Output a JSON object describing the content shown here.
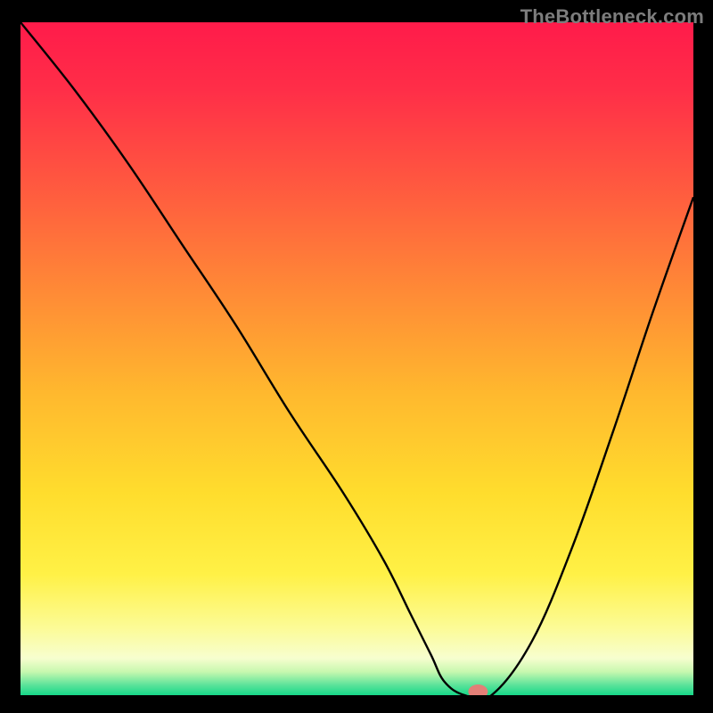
{
  "watermark": "TheBottleneck.com",
  "chart_data": {
    "type": "line",
    "title": "",
    "xlabel": "",
    "ylabel": "",
    "xlim": [
      0,
      100
    ],
    "ylim": [
      0,
      100
    ],
    "x": [
      0,
      8,
      16,
      24,
      32,
      40,
      48,
      54,
      58,
      61,
      63,
      66,
      70,
      76,
      82,
      88,
      94,
      100
    ],
    "values": [
      100,
      90,
      79,
      67,
      55,
      42,
      30,
      20,
      12,
      6,
      2,
      0,
      0,
      8,
      22,
      39,
      57,
      74
    ],
    "minimum_region": {
      "x_start": 63,
      "x_end": 70,
      "y": 0
    },
    "optimal_marker": {
      "x": 68,
      "y": 0
    },
    "gradient_stops": [
      {
        "offset": 0.0,
        "color": "#ff1b4a"
      },
      {
        "offset": 0.1,
        "color": "#ff2e48"
      },
      {
        "offset": 0.25,
        "color": "#ff5b3f"
      },
      {
        "offset": 0.4,
        "color": "#ff8a36"
      },
      {
        "offset": 0.55,
        "color": "#ffb82e"
      },
      {
        "offset": 0.7,
        "color": "#ffdd2d"
      },
      {
        "offset": 0.82,
        "color": "#fff146"
      },
      {
        "offset": 0.9,
        "color": "#fcfb96"
      },
      {
        "offset": 0.945,
        "color": "#f7fecf"
      },
      {
        "offset": 0.965,
        "color": "#c8f8af"
      },
      {
        "offset": 0.985,
        "color": "#5be39a"
      },
      {
        "offset": 1.0,
        "color": "#17d889"
      }
    ],
    "marker_color": "#e37f77",
    "curve_color": "#000000",
    "grid": false,
    "legend": null
  }
}
